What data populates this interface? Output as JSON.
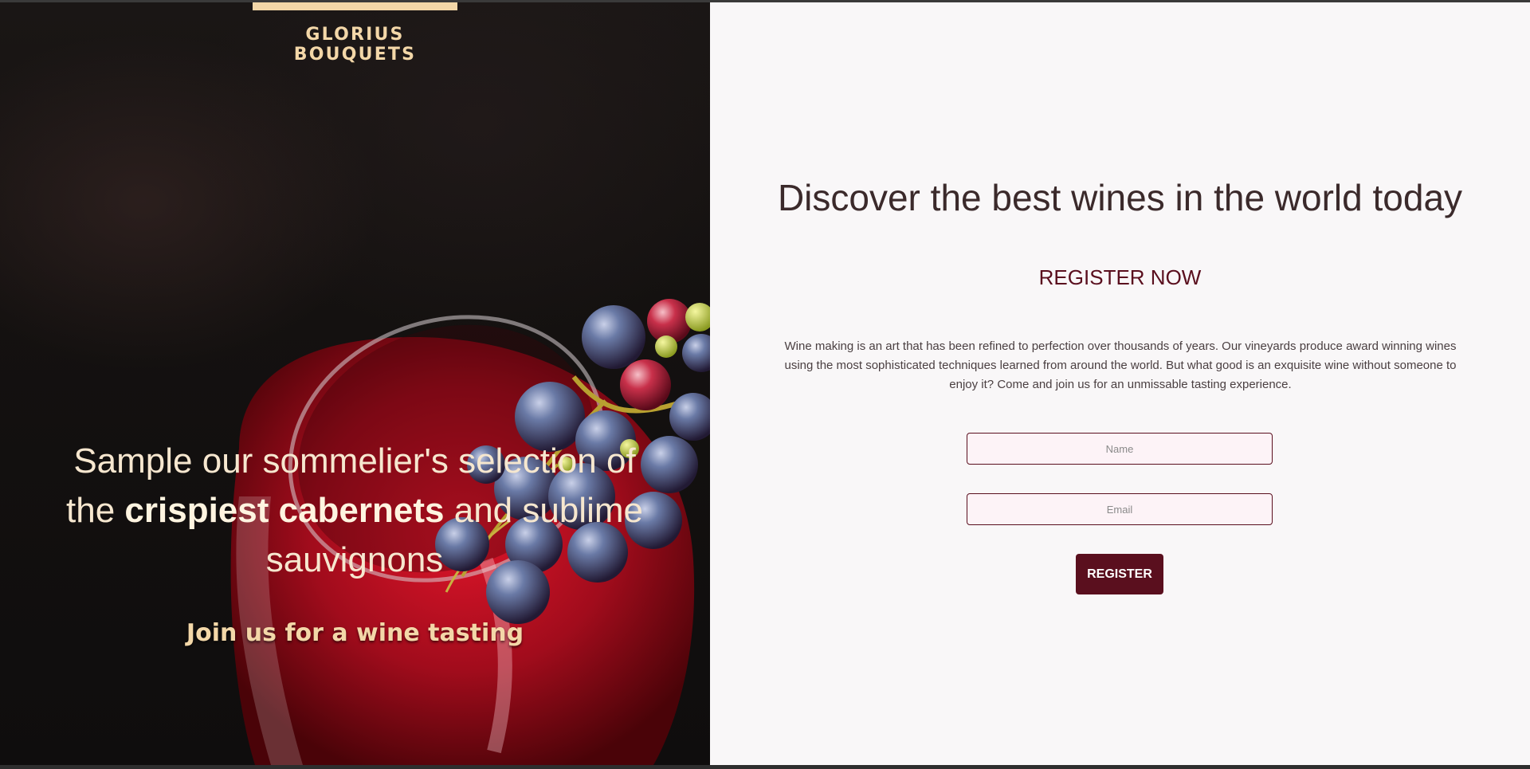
{
  "brand": {
    "name": "GLORIUS BOUQUETS"
  },
  "hero": {
    "headline_part1": "Sample our sommelier's selection of the ",
    "headline_bold": "crispiest cabernets",
    "headline_part2": " and sublime sauvignons",
    "cta": "Join us for a wine tasting"
  },
  "register": {
    "title": "Discover the best wines in the world today",
    "subtitle": "REGISTER NOW",
    "description": "Wine making is an art that has been refined to perfection over thousands of years. Our vineyards produce award winning wines using the most sophisticated techniques learned from around the world. But what good is an exquisite wine without someone to enjoy it? Come and join us for an unmissable tasting experience.",
    "name_placeholder": "Name",
    "email_placeholder": "Email",
    "button_label": "REGISTER"
  },
  "colors": {
    "accent": "#5a0f1e",
    "brand_gold": "#f3d7a8",
    "panel_bg": "#f9f7f8"
  }
}
